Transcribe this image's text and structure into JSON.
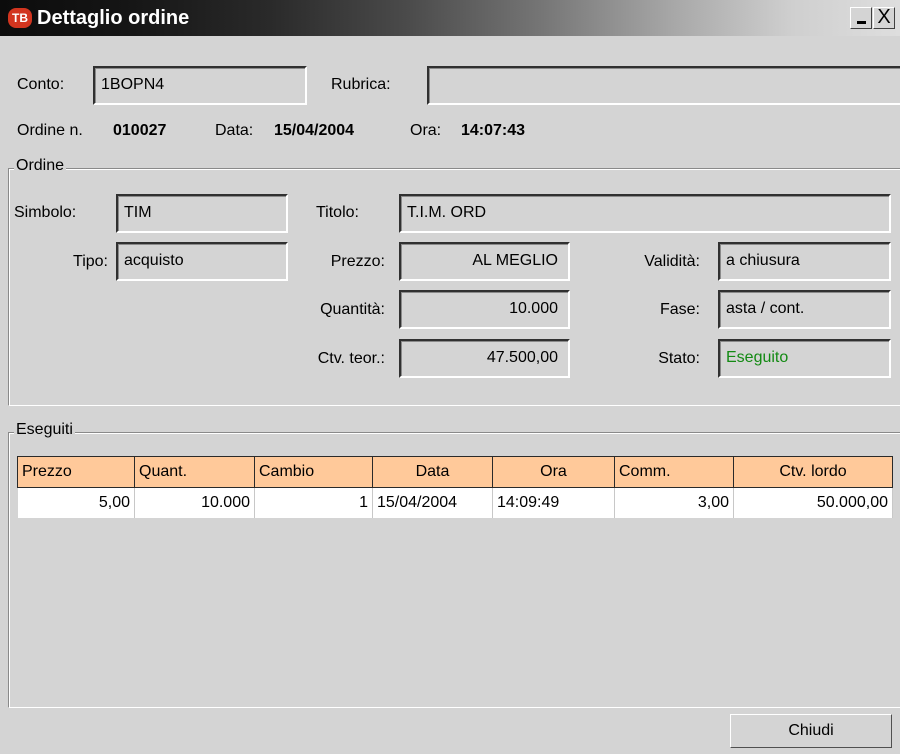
{
  "window": {
    "icon_text": "TB",
    "title": "Dettaglio ordine",
    "minimize_glyph": "_",
    "close_glyph": "X"
  },
  "header": {
    "conto_label": "Conto:",
    "conto_value": "1BOPN4",
    "rubrica_label": "Rubrica:",
    "rubrica_value": "",
    "ordine_label": "Ordine n.",
    "ordine_value": "010027",
    "data_label": "Data:",
    "data_value": "15/04/2004",
    "ora_label": "Ora:",
    "ora_value": "14:07:43"
  },
  "ordine": {
    "group_title": "Ordine",
    "simbolo_label": "Simbolo:",
    "simbolo_value": "TIM",
    "titolo_label": "Titolo:",
    "titolo_value": "T.I.M. ORD",
    "tipo_label": "Tipo:",
    "tipo_value": "acquisto",
    "prezzo_label": "Prezzo:",
    "prezzo_value": "AL MEGLIO",
    "validita_label": "Validità:",
    "validita_value": "a chiusura",
    "quantita_label": "Quantità:",
    "quantita_value": "10.000",
    "fase_label": "Fase:",
    "fase_value": "asta / cont.",
    "ctv_label": "Ctv. teor.:",
    "ctv_value": "47.500,00",
    "stato_label": "Stato:",
    "stato_value": "Eseguito",
    "stato_color": "#138a13"
  },
  "eseguiti": {
    "group_title": "Eseguiti",
    "header_color": "#ffc99a",
    "columns": [
      "Prezzo",
      "Quant.",
      "Cambio",
      "Data",
      "Ora",
      "Comm.",
      "Ctv. lordo"
    ],
    "rows": [
      [
        "5,00",
        "10.000",
        "1",
        "15/04/2004",
        "14:09:49",
        "3,00",
        "50.000,00"
      ]
    ]
  },
  "footer": {
    "close_button": "Chiudi"
  }
}
